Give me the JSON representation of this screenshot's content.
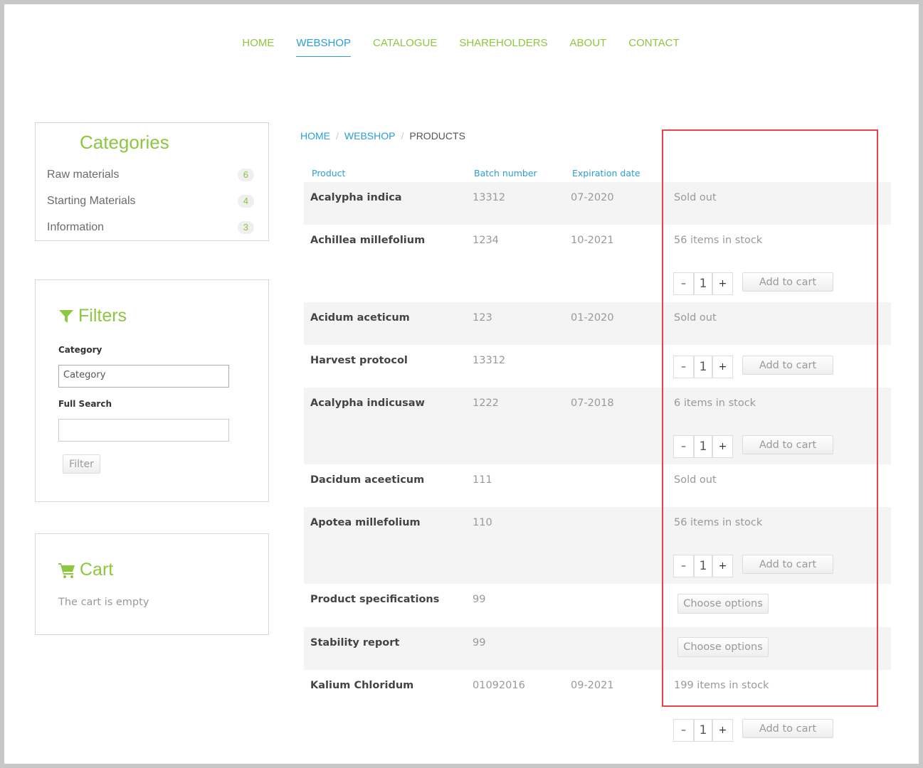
{
  "nav": [
    "HOME",
    "WEBSHOP",
    "CATALOGUE",
    "SHAREHOLDERS",
    "ABOUT",
    "CONTACT"
  ],
  "categories": {
    "title": "Categories",
    "items": [
      {
        "label": "Raw materials",
        "count": "6"
      },
      {
        "label": "Starting Materials",
        "count": "4"
      },
      {
        "label": "Information",
        "count": "3"
      }
    ]
  },
  "filters": {
    "title": "Filters",
    "category_label": "Category",
    "category_value": "Category",
    "search_label": "Full Search",
    "search_value": "",
    "button": "Filter"
  },
  "cart": {
    "title": "Cart",
    "empty": "The cart is empty"
  },
  "breadcrumb": [
    "HOME",
    "WEBSHOP",
    "PRODUCTS"
  ],
  "columns": [
    "Product",
    "Batch number",
    "Expiration date"
  ],
  "add_label": "Add to cart",
  "choose_label": "Choose options",
  "qty": "1",
  "minus": "–",
  "plus": "+",
  "rows": [
    {
      "name": "Acalypha indica",
      "batch": "13312",
      "exp": "07-2020",
      "status": "Sold out"
    },
    {
      "name": "Achillea millefolium",
      "batch": "1234",
      "exp": "10-2021",
      "status": "56 items in stock"
    },
    {
      "name": "Acidum aceticum",
      "batch": "123",
      "exp": "01-2020",
      "status": "Sold out"
    },
    {
      "name": "Harvest protocol",
      "batch": "13312",
      "exp": "",
      "status": ""
    },
    {
      "name": "Acalypha indicusaw",
      "batch": "1222",
      "exp": "07-2018",
      "status": "6 items in stock"
    },
    {
      "name": "Dacidum aceeticum",
      "batch": "111",
      "exp": "",
      "status": "Sold out"
    },
    {
      "name": "Apotea millefolium",
      "batch": "110",
      "exp": "",
      "status": "56 items in stock"
    },
    {
      "name": "Product specifications",
      "batch": "99",
      "exp": "",
      "status": ""
    },
    {
      "name": "Stability report",
      "batch": "99",
      "exp": "",
      "status": ""
    },
    {
      "name": "Kalium Chloridum",
      "batch": "01092016",
      "exp": "09-2021",
      "status": "199 items in stock"
    }
  ]
}
